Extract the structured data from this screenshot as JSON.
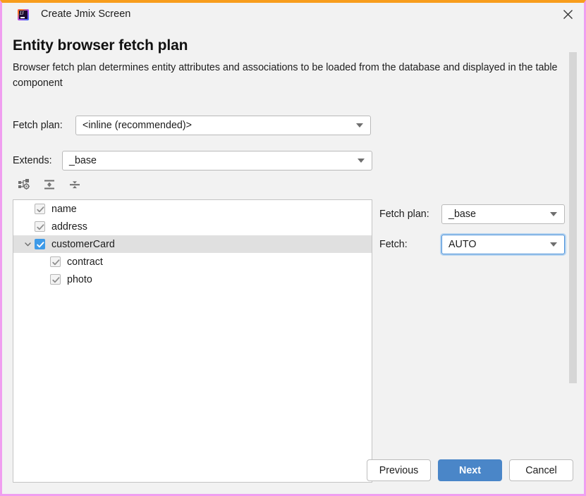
{
  "window": {
    "title": "Create Jmix Screen",
    "app_icon": "intellij-idea-icon",
    "close_icon": "close-icon",
    "border_top_color": "#f89d1c",
    "border_side_color": "#f09ef0"
  },
  "page": {
    "title": "Entity browser fetch plan",
    "description": "Browser fetch plan determines entity attributes and associations to be loaded from the database and displayed in the table component"
  },
  "form": {
    "fetch_plan_label": "Fetch plan:",
    "fetch_plan_value": "<inline (recommended)>",
    "extends_label": "Extends:",
    "extends_value": "_base"
  },
  "toolbar": {
    "items": [
      {
        "name": "configure-fetch-plan-icon",
        "tooltip": "Configure"
      },
      {
        "name": "expand-all-icon",
        "tooltip": "Expand All"
      },
      {
        "name": "collapse-all-icon",
        "tooltip": "Collapse All"
      }
    ]
  },
  "tree": {
    "nodes": [
      {
        "label": "name",
        "indent": 1,
        "checked": true,
        "enabled": false,
        "selected": false,
        "expandable": false
      },
      {
        "label": "address",
        "indent": 1,
        "checked": true,
        "enabled": false,
        "selected": false,
        "expandable": false
      },
      {
        "label": "customerCard",
        "indent": 1,
        "checked": true,
        "enabled": true,
        "selected": true,
        "expandable": true,
        "expanded": true
      },
      {
        "label": "contract",
        "indent": 2,
        "checked": true,
        "enabled": false,
        "selected": false,
        "expandable": false
      },
      {
        "label": "photo",
        "indent": 2,
        "checked": true,
        "enabled": false,
        "selected": false,
        "expandable": false
      }
    ]
  },
  "detail": {
    "fetch_plan_label": "Fetch plan:",
    "fetch_plan_value": "_base",
    "fetch_label": "Fetch:",
    "fetch_value": "AUTO",
    "focused_field": "fetch"
  },
  "footer": {
    "previous_label": "Previous",
    "next_label": "Next",
    "cancel_label": "Cancel",
    "primary_button": "Next",
    "primary_color": "#4a86c8"
  }
}
